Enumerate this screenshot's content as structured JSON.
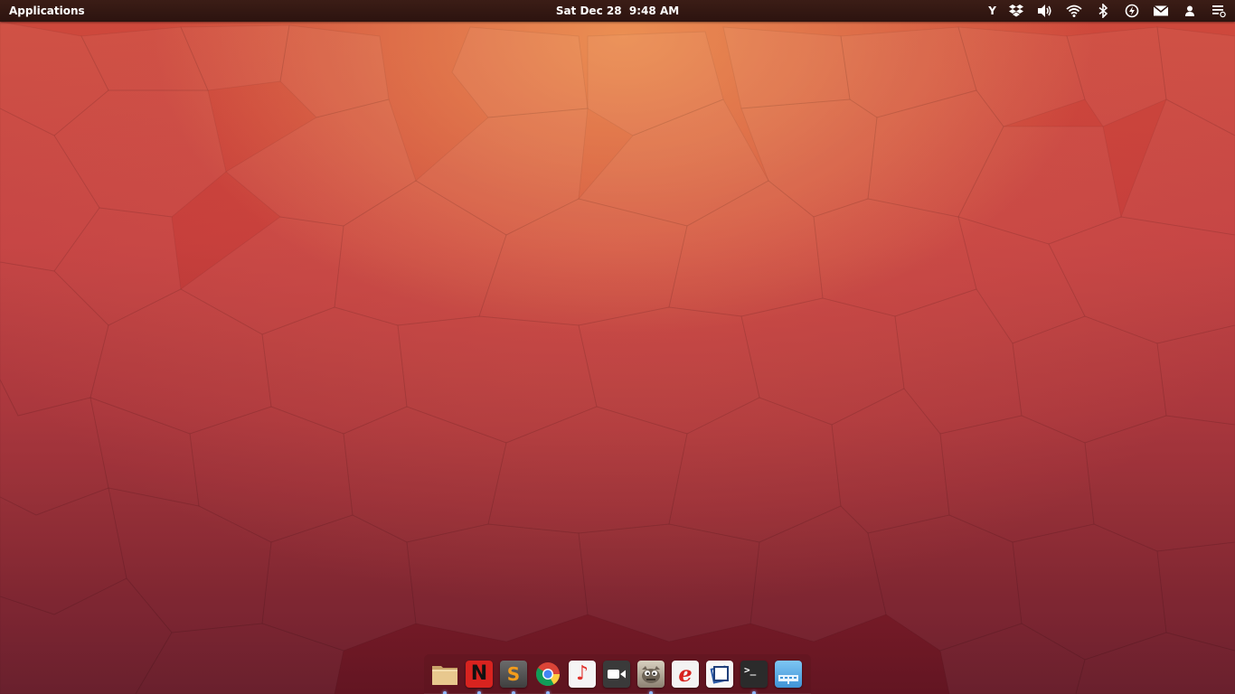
{
  "top_panel": {
    "applications_label": "Applications",
    "clock": "Sat Dec 28  9:48 AM",
    "indicators": {
      "y_label": "Y"
    }
  },
  "dock": {
    "items": [
      {
        "name": "files",
        "icon": "folder-icon",
        "running": true
      },
      {
        "name": "netflix",
        "icon": "netflix-icon",
        "letter": "N",
        "running": true
      },
      {
        "name": "sublime-text",
        "icon": "sublime-text-icon",
        "letter": "S",
        "running": true
      },
      {
        "name": "chrome",
        "icon": "chrome-icon",
        "running": true
      },
      {
        "name": "music",
        "icon": "music-note-icon",
        "glyph": "♪",
        "running": false
      },
      {
        "name": "video",
        "icon": "video-camera-icon",
        "running": false
      },
      {
        "name": "gimp",
        "icon": "gimp-icon",
        "running": true
      },
      {
        "name": "text-editor",
        "icon": "e-letter-icon",
        "letter": "e",
        "running": false
      },
      {
        "name": "photos",
        "icon": "photos-icon",
        "running": false
      },
      {
        "name": "terminal",
        "icon": "terminal-icon",
        "glyph": ">_",
        "running": true
      },
      {
        "name": "show-desktop",
        "icon": "show-desktop-icon",
        "running": false
      }
    ]
  },
  "colors": {
    "panel_bg": "#2c130f",
    "wallpaper_top": "#ec9254",
    "wallpaper_mid": "#c33c3b",
    "wallpaper_bottom": "#621522",
    "running_indicator": "#8fb8ff"
  }
}
